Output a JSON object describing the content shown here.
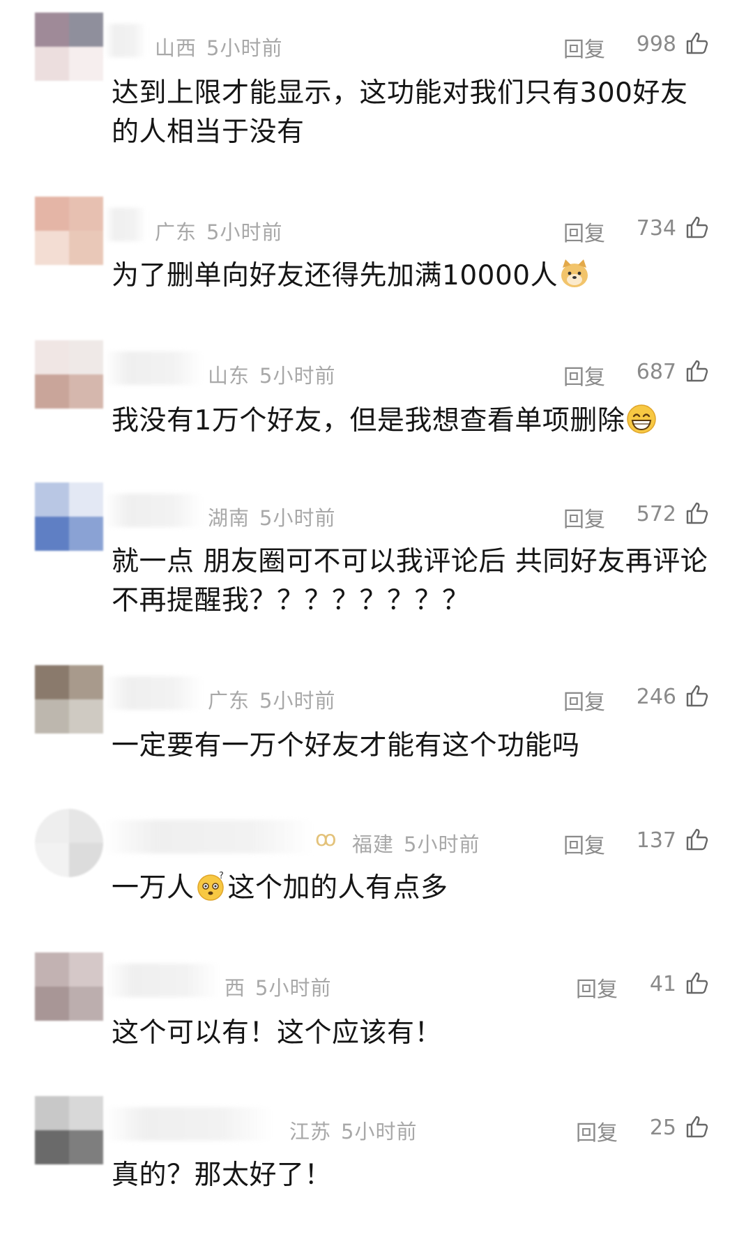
{
  "comments": [
    {
      "region": "山西",
      "time": "5小时前",
      "reply_label": "回复",
      "likes": "998",
      "text_segments": [
        {
          "t": "达到上限才能显示，这功能对我们只有300好友的人相当于没有"
        }
      ]
    },
    {
      "region": "广东",
      "time": "5小时前",
      "reply_label": "回复",
      "likes": "734",
      "text_segments": [
        {
          "t": "为了删单向好友还得先加满10000人"
        },
        {
          "emoji": "doge-emoji"
        }
      ]
    },
    {
      "region": "山东",
      "time": "5小时前",
      "reply_label": "回复",
      "likes": "687",
      "text_segments": [
        {
          "t": "我没有1万个好友，但是我想查看单项删除"
        },
        {
          "emoji": "grin-emoji"
        }
      ]
    },
    {
      "region": "湖南",
      "time": "5小时前",
      "reply_label": "回复",
      "likes": "572",
      "text_segments": [
        {
          "t": "就一点  朋友圈可不可以我评论后 共同好友再评论不再提醒我？？？？？？？？"
        }
      ]
    },
    {
      "region": "广东",
      "time": "5小时前",
      "reply_label": "回复",
      "likes": "246",
      "text_segments": [
        {
          "t": "一定要有一万个好友才能有这个功能吗"
        }
      ]
    },
    {
      "region": "福建",
      "time": "5小时前",
      "reply_label": "回复",
      "likes": "137",
      "text_segments": [
        {
          "t": "一万人"
        },
        {
          "emoji": "confused-emoji"
        },
        {
          "t": "这个加的人有点多"
        }
      ]
    },
    {
      "region": "西",
      "time": "5小时前",
      "reply_label": "回复",
      "likes": "41",
      "text_segments": [
        {
          "t": "这个可以有！这个应该有！"
        }
      ]
    },
    {
      "region": "江苏",
      "time": "5小时前",
      "reply_label": "回复",
      "likes": "25",
      "text_segments": [
        {
          "t": "真的？那太好了！"
        }
      ]
    }
  ],
  "icons": {
    "like": "thumbs-up-icon"
  },
  "colors": {
    "meta_text": "#a8a8a8",
    "action_text": "#8a8a8a",
    "body_text": "#151515"
  }
}
